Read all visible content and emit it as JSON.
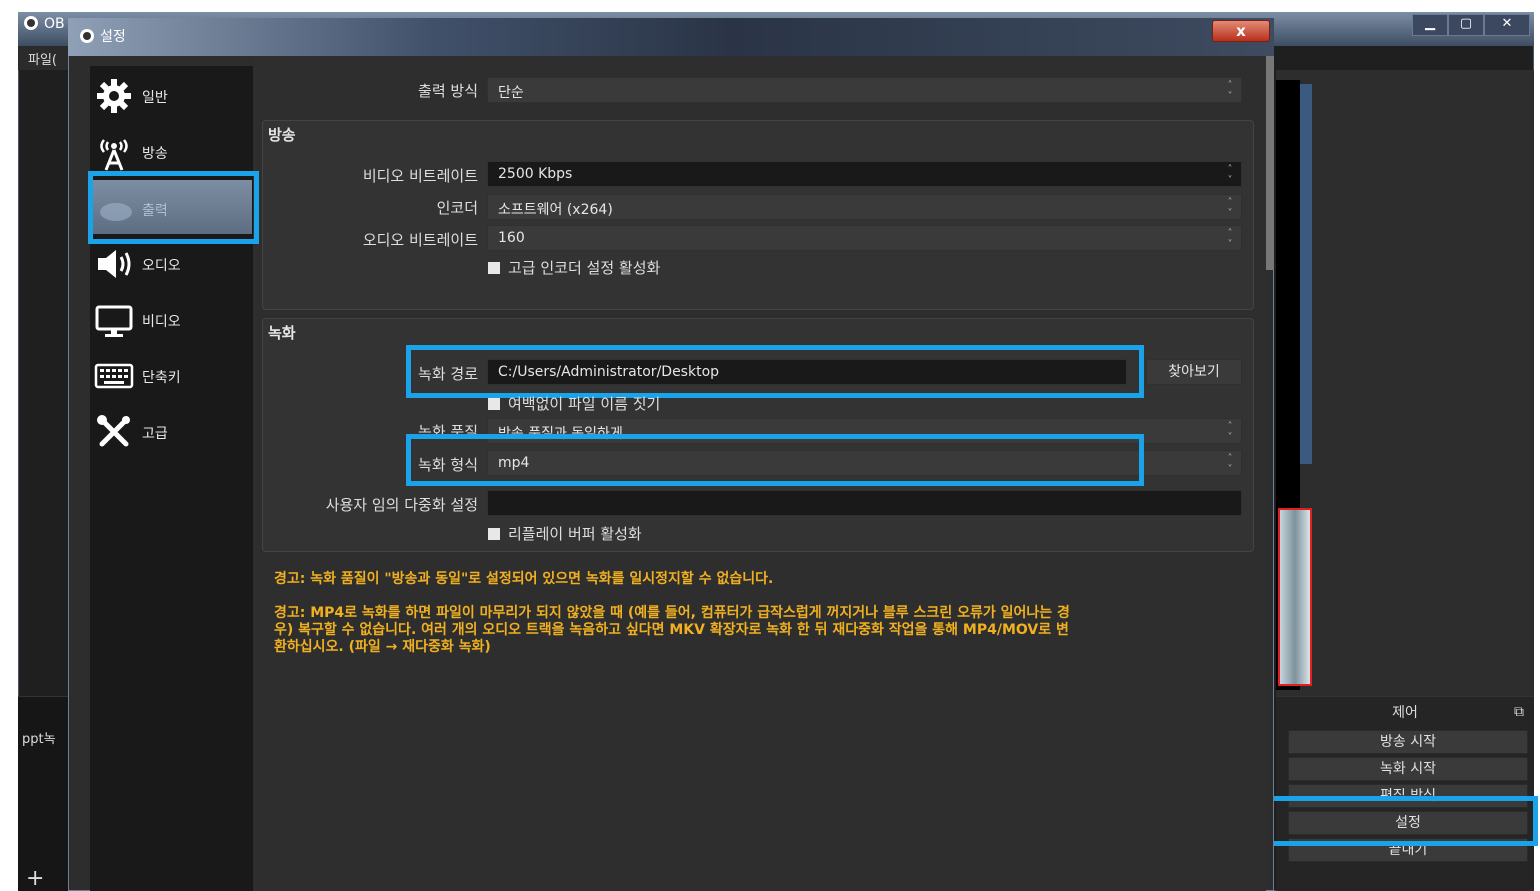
{
  "main_window": {
    "title": "OB",
    "menu_file": "파일(",
    "dock_item": "ppt녹",
    "dock_plus": "+",
    "controls": {
      "title": "제어",
      "buttons": [
        "방송 시작",
        "녹화 시작",
        "편집 방식",
        "설정",
        "끝내기"
      ]
    }
  },
  "dialog": {
    "title": "설정",
    "close": "x",
    "sidebar": [
      {
        "label": "일반",
        "icon": "gear-icon"
      },
      {
        "label": "방송",
        "icon": "broadcast-icon"
      },
      {
        "label": "출력",
        "icon": "output-icon"
      },
      {
        "label": "오디오",
        "icon": "speaker-icon"
      },
      {
        "label": "비디오",
        "icon": "monitor-icon"
      },
      {
        "label": "단축키",
        "icon": "keyboard-icon"
      },
      {
        "label": "고급",
        "icon": "tools-icon"
      }
    ],
    "output_mode": {
      "label": "출력 방식",
      "value": "단순"
    },
    "streaming": {
      "title": "방송",
      "video_bitrate": {
        "label": "비디오 비트레이트",
        "value": "2500 Kbps"
      },
      "encoder": {
        "label": "인코더",
        "value": "소프트웨어 (x264)"
      },
      "audio_bitrate": {
        "label": "오디오 비트레이트",
        "value": "160"
      },
      "advanced_encoder": "고급 인코더 설정 활성화"
    },
    "recording": {
      "title": "녹화",
      "path": {
        "label": "녹화 경로",
        "value": "C:/Users/Administrator/Desktop"
      },
      "browse": "찾아보기",
      "no_space": "여백없이 파일 이름 짓기",
      "quality": {
        "label": "녹화 품질",
        "value": "방송 품질과 동일하게"
      },
      "format": {
        "label": "녹화 형식",
        "value": "mp4"
      },
      "mux": {
        "label": "사용자 임의 다중화 설정",
        "value": ""
      },
      "replay": "리플레이 버퍼 활성화"
    },
    "warnings": [
      "경고: 녹화 품질이 \"방송과 동일\"로 설정되어 있으면 녹화를 일시정지할 수 없습니다.",
      "경고: MP4로 녹화를 하면 파일이 마무리가 되지 않았을 때 (예를 들어, 컴퓨터가 급작스럽게 꺼지거나 블루 스크린 오류가 일어나는 경",
      "우) 복구할 수 없습니다. 여러 개의 오디오 트랙을 녹음하고 싶다면 MKV 확장자로 녹화 한 뒤 재다중화 작업을 통해 MP4/MOV로 변",
      "환하십시오. (파일 → 재다중화 녹화)"
    ]
  },
  "colors": {
    "highlight": "#1aa3e8",
    "warning": "#f0b020"
  }
}
